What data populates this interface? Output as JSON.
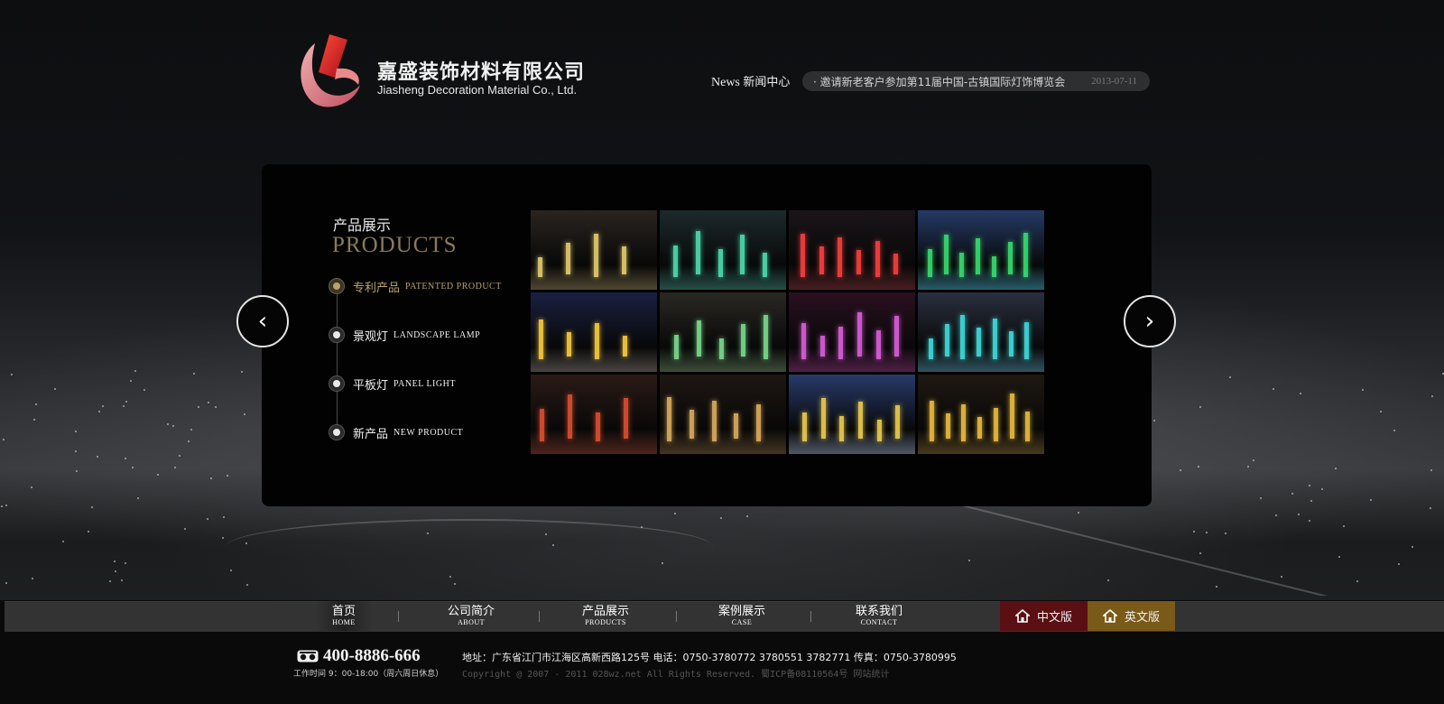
{
  "header": {
    "company_cn": "嘉盛装饰材料有限公司",
    "company_en": "Jiasheng Decoration Material Co., Ltd."
  },
  "news": {
    "label_en": "News",
    "label_cn": "新闻中心",
    "headline": "· 邀请新老客户参加第11届中国-古镇国际灯饰博览会",
    "date": "2013-07-11"
  },
  "products": {
    "title_cn": "产品展示",
    "title_en": "PRODUCTS",
    "categories": [
      {
        "cn": "专利产品",
        "en": "PATENTED PRODUCT",
        "active": true
      },
      {
        "cn": "景观灯",
        "en": "LANDSCAPE LAMP",
        "active": false
      },
      {
        "cn": "平板灯",
        "en": "PANEL LIGHT",
        "active": false
      },
      {
        "cn": "新产品",
        "en": "NEW PRODUCT",
        "active": false
      }
    ],
    "thumbnails": [
      {
        "bg": "#2a2420",
        "accent": "#e8d070"
      },
      {
        "bg": "#1c2a2c",
        "accent": "#4fe0b0"
      },
      {
        "bg": "#1a1418",
        "accent": "#ff4040"
      },
      {
        "bg": "#243a66",
        "accent": "#39e070"
      },
      {
        "bg": "#1a2040",
        "accent": "#ffd040"
      },
      {
        "bg": "#2a2822",
        "accent": "#7de090"
      },
      {
        "bg": "#2a1020",
        "accent": "#e060e0"
      },
      {
        "bg": "#2a3040",
        "accent": "#40e0e0"
      },
      {
        "bg": "#2a1a16",
        "accent": "#e05030"
      },
      {
        "bg": "#1e1612",
        "accent": "#e0b060"
      },
      {
        "bg": "#283a6a",
        "accent": "#f0d050"
      },
      {
        "bg": "#1e1812",
        "accent": "#f0c040"
      }
    ],
    "prev_glyph": "‹",
    "next_glyph": "›"
  },
  "nav": {
    "items": [
      {
        "cn": "首页",
        "en": "HOME"
      },
      {
        "cn": "公司简介",
        "en": "ABOUT"
      },
      {
        "cn": "产品展示",
        "en": "PRODUCTS"
      },
      {
        "cn": "案例展示",
        "en": "CASE"
      },
      {
        "cn": "联系我们",
        "en": "CONTACT"
      }
    ],
    "lang_cn": "中文版",
    "lang_en": "英文版",
    "lang_cn_color": "#5a0f12",
    "lang_en_color": "#7a5a18"
  },
  "footer": {
    "phone": "400-8886-666",
    "hours": "工作时间 9：00-18:00（周六周日休息）",
    "address": "地址：广东省江门市江海区高新西路125号 电话：0750-3780772 3780551 3782771 传真：0750-3780995",
    "copyright": "Copyright @ 2007 - 2011 028wz.net All Rights Reserved. 蜀ICP备08110564号 网站统计"
  },
  "colors": {
    "accent_gold": "#b9a36b",
    "logo_red": "#d42a2a"
  }
}
